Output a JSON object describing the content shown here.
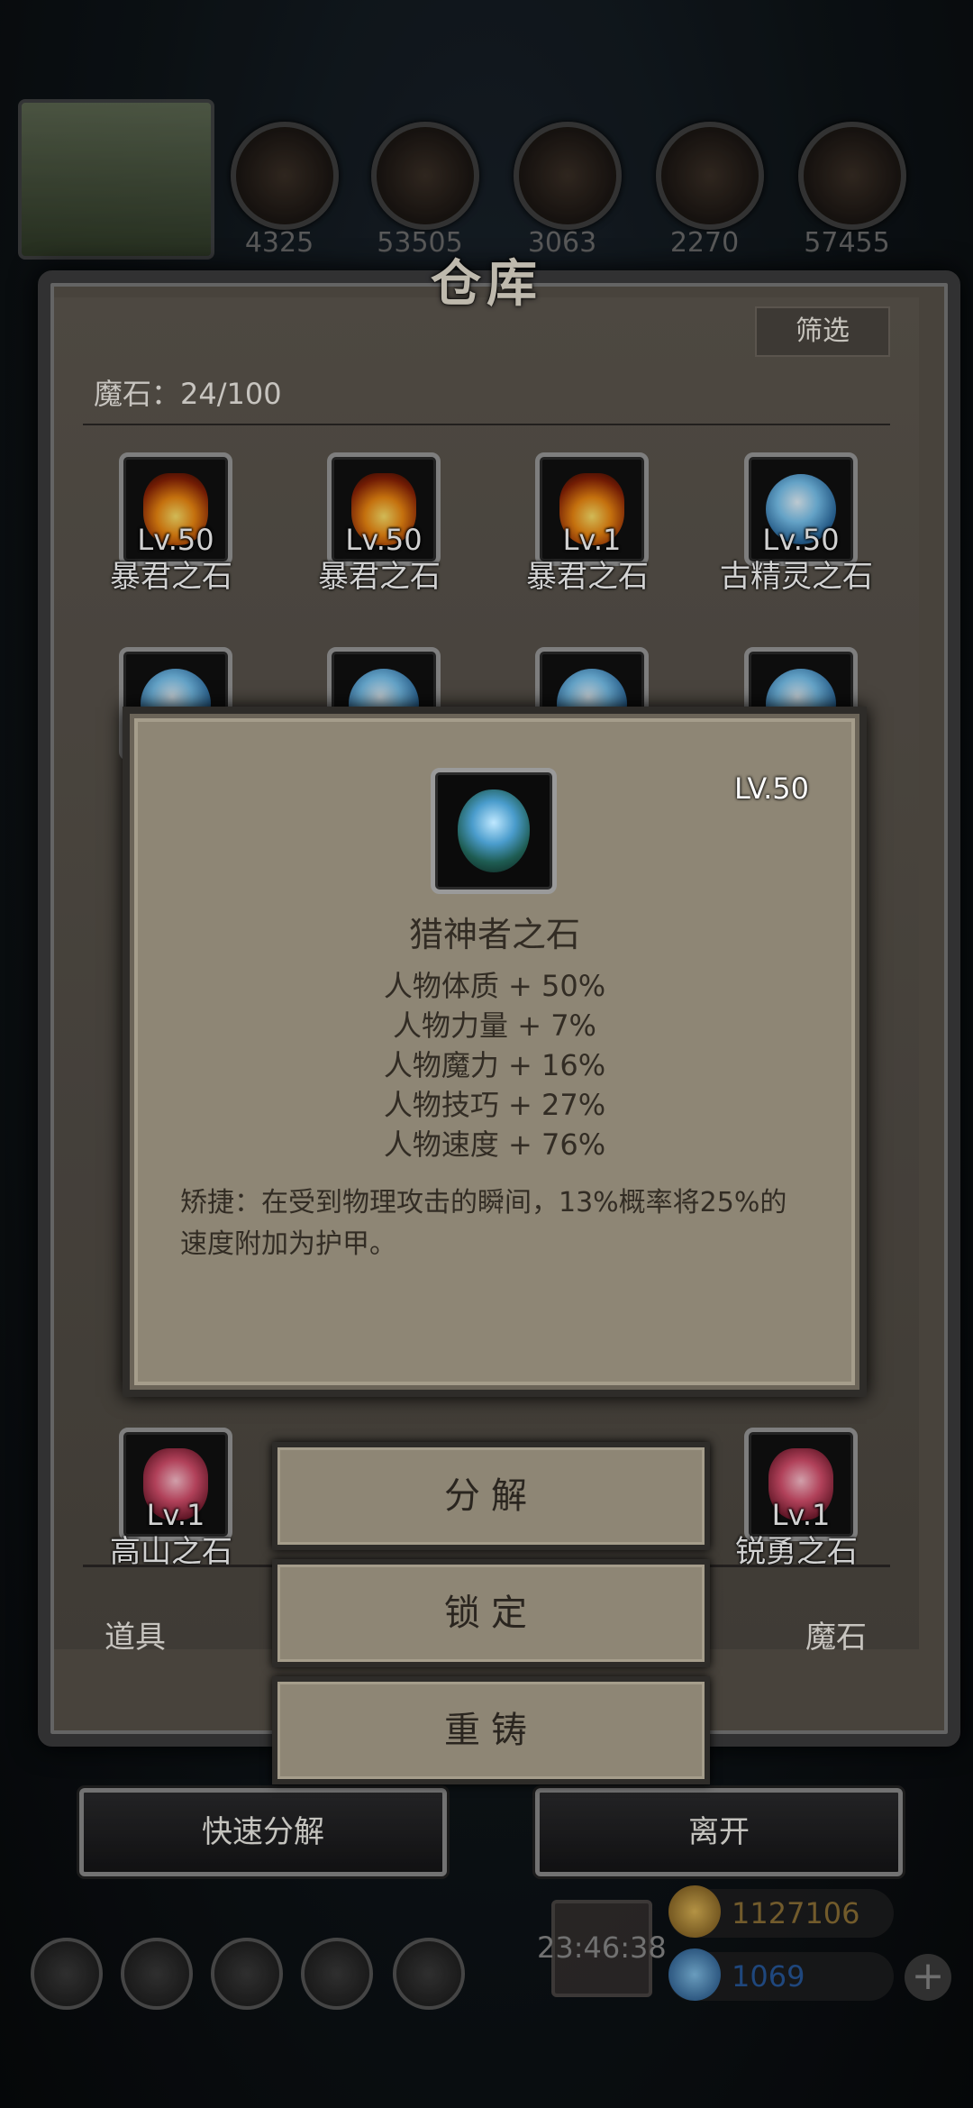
{
  "resources": {
    "values": [
      "4325",
      "53505",
      "3063",
      "2270",
      "57455"
    ]
  },
  "warehouse": {
    "title": "仓库",
    "filter_label": "筛选",
    "count_label": "魔石：24/100"
  },
  "items": [
    {
      "level": "Lv.50",
      "name": "暴君之石",
      "gem": "fire"
    },
    {
      "level": "Lv.50",
      "name": "暴君之石",
      "gem": "fire"
    },
    {
      "level": "Lv.1",
      "name": "暴君之石",
      "gem": "fire"
    },
    {
      "level": "Lv.50",
      "name": "古精灵之石",
      "gem": "blue"
    }
  ],
  "bottom_row": [
    {
      "level": "Lv.1",
      "name": "高山之石",
      "gem": "red"
    },
    {
      "level": "Lv.1",
      "name": "锐勇之石",
      "gem": "red"
    }
  ],
  "tabs": {
    "left": "道具",
    "right": "魔石"
  },
  "popup": {
    "level": "LV.50",
    "name": "猎神者之石",
    "stats": [
      "人物体质 + 50%",
      "人物力量 + 7%",
      "人物魔力 + 16%",
      "人物技巧 + 27%",
      "人物速度 + 76%"
    ],
    "description": "矫捷：在受到物理攻击的瞬间，13%概率将25%的速度附加为护甲。"
  },
  "actions": {
    "decompose": "分解",
    "lock": "锁定",
    "recast": "重铸"
  },
  "footer": {
    "quick_decompose": "快速分解",
    "leave": "离开"
  },
  "hud": {
    "timer": "23:46:38",
    "gold": "1127106",
    "gems": "1069",
    "plus": "+"
  },
  "colors": {
    "popup_bg": "#8e8675",
    "frame_bg": "#58524a",
    "gold_text": "#9a7a3a",
    "gem_text": "#2a5fa8"
  }
}
